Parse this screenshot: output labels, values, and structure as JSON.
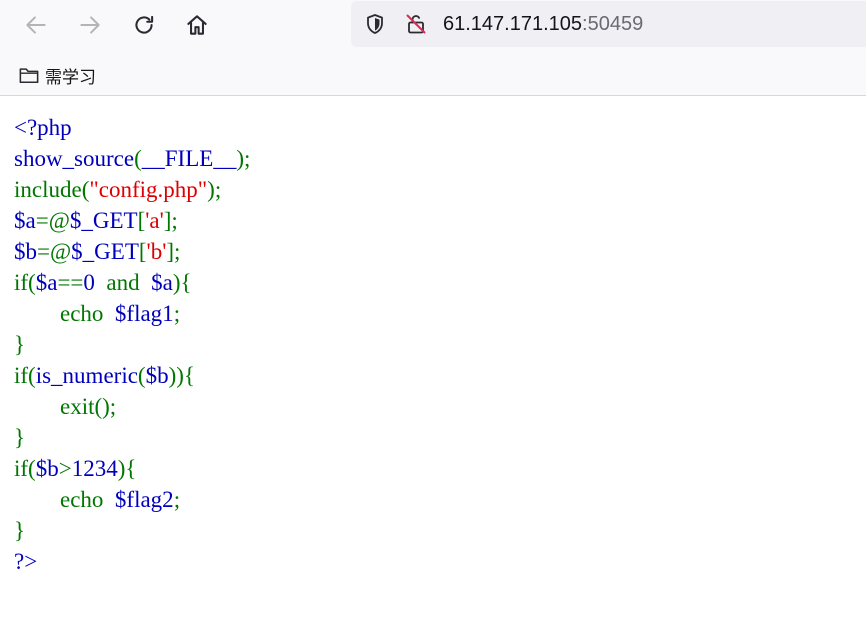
{
  "browser": {
    "url_host": "61.147.171.105",
    "url_port": ":50459",
    "bookmark_label": "需学习"
  },
  "colors": {
    "php_default": "#0000bb",
    "php_keyword": "#007700",
    "php_string": "#dd0000"
  },
  "source_lines": [
    [
      {
        "t": "<?php",
        "c": "def"
      }
    ],
    [
      {
        "t": "show_source",
        "c": "def"
      },
      {
        "t": "(",
        "c": "kw"
      },
      {
        "t": "__FILE__",
        "c": "def"
      },
      {
        "t": ");",
        "c": "kw"
      }
    ],
    [
      {
        "t": "include(",
        "c": "kw"
      },
      {
        "t": "\"config.php\"",
        "c": "str"
      },
      {
        "t": ");",
        "c": "kw"
      }
    ],
    [
      {
        "t": "$a",
        "c": "def"
      },
      {
        "t": "=@",
        "c": "kw"
      },
      {
        "t": "$_GET",
        "c": "def"
      },
      {
        "t": "[",
        "c": "kw"
      },
      {
        "t": "'a'",
        "c": "str"
      },
      {
        "t": "];",
        "c": "kw"
      }
    ],
    [
      {
        "t": "$b",
        "c": "def"
      },
      {
        "t": "=@",
        "c": "kw"
      },
      {
        "t": "$_GET",
        "c": "def"
      },
      {
        "t": "[",
        "c": "kw"
      },
      {
        "t": "'b'",
        "c": "str"
      },
      {
        "t": "];",
        "c": "kw"
      }
    ],
    [
      {
        "t": "if(",
        "c": "kw"
      },
      {
        "t": "$a",
        "c": "def"
      },
      {
        "t": "==",
        "c": "kw"
      },
      {
        "t": "0 ",
        "c": "def"
      },
      {
        "t": " and ",
        "c": "kw"
      },
      {
        "t": " $a",
        "c": "def"
      },
      {
        "t": "){",
        "c": "kw"
      }
    ],
    [
      {
        "t": "        echo ",
        "c": "kw"
      },
      {
        "t": " $flag1",
        "c": "def"
      },
      {
        "t": ";",
        "c": "kw"
      }
    ],
    [
      {
        "t": "}",
        "c": "kw"
      }
    ],
    [
      {
        "t": "if(",
        "c": "kw"
      },
      {
        "t": "is_numeric",
        "c": "def"
      },
      {
        "t": "(",
        "c": "kw"
      },
      {
        "t": "$b",
        "c": "def"
      },
      {
        "t": ")){",
        "c": "kw"
      }
    ],
    [
      {
        "t": "        exit();",
        "c": "kw"
      }
    ],
    [
      {
        "t": "}",
        "c": "kw"
      }
    ],
    [
      {
        "t": "if(",
        "c": "kw"
      },
      {
        "t": "$b",
        "c": "def"
      },
      {
        "t": ">",
        "c": "kw"
      },
      {
        "t": "1234",
        "c": "def"
      },
      {
        "t": "){",
        "c": "kw"
      }
    ],
    [
      {
        "t": "        echo ",
        "c": "kw"
      },
      {
        "t": " $flag2",
        "c": "def"
      },
      {
        "t": ";",
        "c": "kw"
      }
    ],
    [
      {
        "t": "}",
        "c": "kw"
      }
    ],
    [
      {
        "t": "?>",
        "c": "def"
      }
    ]
  ]
}
